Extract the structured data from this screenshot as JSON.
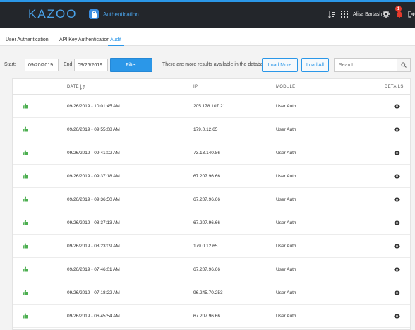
{
  "header": {
    "logo": "KAZOO",
    "app_name": "Authentication",
    "user_name": "Alisa Bartash",
    "notification_count": "1",
    "accent_color": "#2b97e8",
    "background_color": "#23262b",
    "icons": [
      "sort-icon",
      "apps-grid-icon",
      "gear-icon",
      "bell-icon",
      "logout-icon"
    ]
  },
  "tabs": [
    {
      "label": "User Authentication",
      "active": false
    },
    {
      "label": "API Key Authentication",
      "active": false
    },
    {
      "label": "Audit",
      "active": true
    }
  ],
  "filter": {
    "start_label": "Start:",
    "start_value": "09/20/2019",
    "end_label": "End:",
    "end_value": "09/26/2019",
    "filter_button": "Filter",
    "info_text": "There are more results available in the database",
    "load_more_button": "Load More",
    "load_all_button": "Load All",
    "search_placeholder": "Search"
  },
  "table": {
    "columns": [
      "DATE",
      "IP",
      "MODULE",
      "DETAILS"
    ],
    "rows": [
      {
        "date": "09/26/2019 - 10:01:45 AM",
        "ip": "205.178.107.21",
        "module": "User Auth"
      },
      {
        "date": "09/26/2019 - 09:55:08 AM",
        "ip": "179.0.12.65",
        "module": "User Auth"
      },
      {
        "date": "09/26/2019 - 09:41:02 AM",
        "ip": "73.13.140.86",
        "module": "User Auth"
      },
      {
        "date": "09/26/2019 - 09:37:18 AM",
        "ip": "67.207.96.66",
        "module": "User Auth"
      },
      {
        "date": "09/26/2019 - 09:36:50 AM",
        "ip": "67.207.96.66",
        "module": "User Auth"
      },
      {
        "date": "09/26/2019 - 08:37:13 AM",
        "ip": "67.207.96.66",
        "module": "User Auth"
      },
      {
        "date": "09/26/2019 - 08:23:09 AM",
        "ip": "179.0.12.65",
        "module": "User Auth"
      },
      {
        "date": "09/26/2019 - 07:46:01 AM",
        "ip": "67.207.96.66",
        "module": "User Auth"
      },
      {
        "date": "09/26/2019 - 07:18:22 AM",
        "ip": "96.245.70.253",
        "module": "User Auth"
      },
      {
        "date": "09/26/2019 - 06:45:54 AM",
        "ip": "67.207.96.66",
        "module": "User Auth"
      }
    ],
    "success_icon": "thumbs-up-icon",
    "success_color": "#4caf50",
    "details_icon": "eye-icon"
  }
}
